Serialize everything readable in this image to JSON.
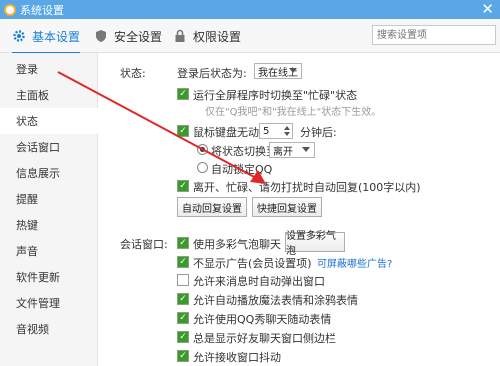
{
  "window": {
    "title": "系统设置",
    "close": "✕"
  },
  "tabs": [
    {
      "label": "基本设置",
      "icon": "gear-icon"
    },
    {
      "label": "安全设置",
      "icon": "shield-icon"
    },
    {
      "label": "权限设置",
      "icon": "lock-icon"
    }
  ],
  "search": {
    "placeholder": "搜索设置项"
  },
  "sidebar": {
    "items": [
      {
        "label": "登录"
      },
      {
        "label": "主面板"
      },
      {
        "label": "状态"
      },
      {
        "label": "会话窗口"
      },
      {
        "label": "信息展示"
      },
      {
        "label": "提醒"
      },
      {
        "label": "热键"
      },
      {
        "label": "声音"
      },
      {
        "label": "软件更新"
      },
      {
        "label": "文件管理"
      },
      {
        "label": "音视频"
      }
    ]
  },
  "status_section": {
    "heading": "状态:",
    "online_after_login_label": "登录后状态为:",
    "online_after_login_value": "我在线上",
    "fullscreen_busy_label": "运行全屏程序时切换至\"忙碌\"状态",
    "fullscreen_busy_note": "仅在\"Q我吧\"和\"我在线上\"状态下生效。",
    "idle_label": "鼠标键盘无动作",
    "idle_minutes": "5",
    "idle_minutes_unit": "分钟后:",
    "switch_to_label": "将状态切换至",
    "switch_to_value": "离开",
    "auto_lock_label": "自动锁定QQ",
    "auto_reply_label": "离开、忙碌、请勿打扰时自动回复(100字以内)",
    "auto_reply_button": "自动回复设置",
    "quick_reply_button": "快捷回复设置"
  },
  "chat_section": {
    "heading": "会话窗口:",
    "items": [
      {
        "label": "使用多彩气泡聊天",
        "checked": true
      },
      {
        "label": "不显示广告(会员设置项)",
        "checked": true
      },
      {
        "label": "允许来消息时自动弹出窗口",
        "checked": false
      },
      {
        "label": "允许自动播放魔法表情和涂鸦表情",
        "checked": true
      },
      {
        "label": "允许使用QQ秀聊天随动表情",
        "checked": true
      },
      {
        "label": "总是显示好友聊天窗口侧边栏",
        "checked": true
      },
      {
        "label": "允许接收窗口抖动",
        "checked": true
      }
    ],
    "bubble_button": "设置多彩气泡",
    "ads_link": "可屏蔽哪些广告?"
  },
  "check_glyph": "✓",
  "colors": {
    "title_bar": "#5aa7e8",
    "accent": "#1a7fd8",
    "annotation_arrow": "#e02828"
  }
}
